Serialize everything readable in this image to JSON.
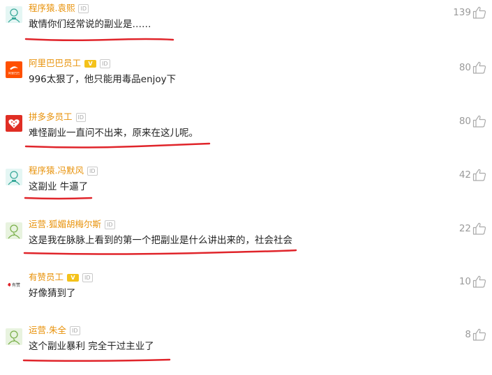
{
  "comments": [
    {
      "name": "程序猿.袁熙",
      "vip": false,
      "id_badge": "ID",
      "text": "敢情你们经常说的副业是……",
      "likes": "139",
      "avatar": "programmer-avatar"
    },
    {
      "name": "阿里巴巴员工",
      "vip": true,
      "vip_label": "V",
      "id_badge": "ID",
      "text": "996太狠了，他只能用毒品enjoy下",
      "likes": "80",
      "avatar": "alibaba-logo",
      "avatar_text": "阿里巴巴"
    },
    {
      "name": "拼多多员工",
      "vip": false,
      "id_badge": "ID",
      "text": "难怪副业一直问不出来，原来在这儿呢。",
      "likes": "80",
      "avatar": "pinduoduo-logo"
    },
    {
      "name": "程序猿.冯默风",
      "vip": false,
      "id_badge": "ID",
      "text": "这副业 牛逼了",
      "likes": "42",
      "avatar": "programmer-avatar"
    },
    {
      "name": "运营.狐媚胡梅尔斯",
      "vip": false,
      "id_badge": "ID",
      "text": "这是我在脉脉上看到的第一个把副业是什么讲出来的，社会社会",
      "likes": "22",
      "avatar": "operations-avatar"
    },
    {
      "name": "有赞员工",
      "vip": true,
      "vip_label": "V",
      "id_badge": "ID",
      "text": "好像猜到了",
      "likes": "10",
      "avatar": "youzan-logo",
      "avatar_text": "有赞"
    },
    {
      "name": "运营.朱全",
      "vip": false,
      "id_badge": "ID",
      "text": "这个副业暴利 完全干过主业了",
      "likes": "8",
      "avatar": "operations-avatar"
    }
  ],
  "colors": {
    "name": "#e8920a",
    "underline": "#e0242a",
    "count": "#9a9a9a"
  }
}
